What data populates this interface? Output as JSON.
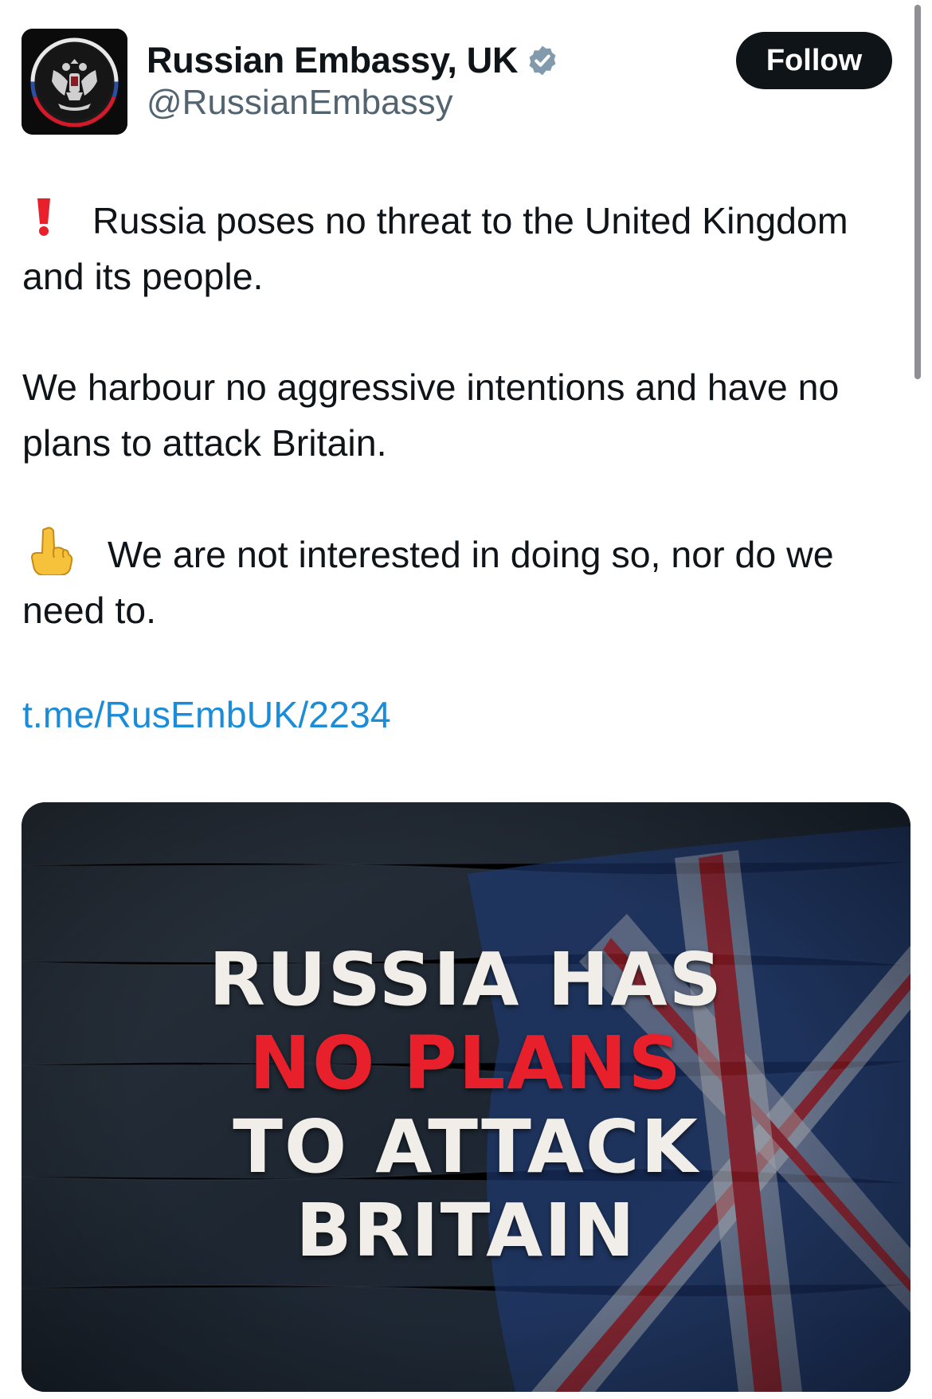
{
  "author": {
    "display_name": "Russian Embassy, UK",
    "handle": "@RussianEmbassy",
    "verified": true,
    "avatar_icon": "russian-coat-of-arms-logo"
  },
  "follow_button": {
    "label": "Follow"
  },
  "tweet": {
    "paragraph_1": {
      "emoji": "red-exclamation-mark",
      "text": "Russia poses no threat to the United Kingdom and its people."
    },
    "paragraph_2": {
      "text": "We harbour no aggressive intentions and have no plans to attack Britain."
    },
    "paragraph_3": {
      "emoji": "index-pointing-up",
      "text": "We are not interested in doing so, nor do we need to."
    },
    "link": "t.me/RusEmbUK/2234"
  },
  "media": {
    "headline_line_1": "RUSSIA HAS",
    "headline_line_2": "NO PLANS",
    "headline_line_3": "TO ATTACK",
    "headline_line_4": "BRITAIN",
    "colors": {
      "headline_white": "#f1eee9",
      "headline_red": "#e8202b"
    }
  },
  "colors": {
    "link": "#1a8cd8",
    "handle": "#536471",
    "verified_badge": "#829aab",
    "follow_bg": "#0f1419"
  }
}
